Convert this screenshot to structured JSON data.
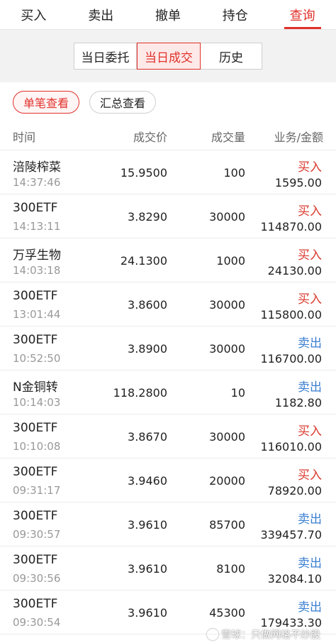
{
  "nav": {
    "tabs": [
      {
        "label": "买入",
        "active": false
      },
      {
        "label": "卖出",
        "active": false
      },
      {
        "label": "撤单",
        "active": false
      },
      {
        "label": "持仓",
        "active": false
      },
      {
        "label": "查询",
        "active": true
      }
    ]
  },
  "segments": [
    {
      "label": "当日委托",
      "active": false
    },
    {
      "label": "当日成交",
      "active": true
    },
    {
      "label": "历史",
      "active": false
    }
  ],
  "chips": [
    {
      "label": "单笔查看",
      "active": true
    },
    {
      "label": "汇总查看",
      "active": false
    }
  ],
  "table": {
    "headers": {
      "time": "时间",
      "price": "成交价",
      "qty": "成交量",
      "amount": "业务/金额"
    },
    "rows": [
      {
        "name": "涪陵榨菜",
        "time": "14:37:46",
        "price": "15.9500",
        "qty": "100",
        "side": "买入",
        "side_type": "buy",
        "amount": "1595.00"
      },
      {
        "name": "300ETF",
        "time": "14:13:11",
        "price": "3.8290",
        "qty": "30000",
        "side": "买入",
        "side_type": "buy",
        "amount": "114870.00"
      },
      {
        "name": "万孚生物",
        "time": "14:03:18",
        "price": "24.1300",
        "qty": "1000",
        "side": "买入",
        "side_type": "buy",
        "amount": "24130.00"
      },
      {
        "name": "300ETF",
        "time": "13:01:44",
        "price": "3.8600",
        "qty": "30000",
        "side": "买入",
        "side_type": "buy",
        "amount": "115800.00"
      },
      {
        "name": "300ETF",
        "time": "10:52:50",
        "price": "3.8900",
        "qty": "30000",
        "side": "卖出",
        "side_type": "sell",
        "amount": "116700.00"
      },
      {
        "name": "N金铜转",
        "time": "10:14:03",
        "price": "118.2800",
        "qty": "10",
        "side": "卖出",
        "side_type": "sell",
        "amount": "1182.80"
      },
      {
        "name": "300ETF",
        "time": "10:10:08",
        "price": "3.8670",
        "qty": "30000",
        "side": "买入",
        "side_type": "buy",
        "amount": "116010.00"
      },
      {
        "name": "300ETF",
        "time": "09:31:17",
        "price": "3.9460",
        "qty": "20000",
        "side": "买入",
        "side_type": "buy",
        "amount": "78920.00"
      },
      {
        "name": "300ETF",
        "time": "09:30:57",
        "price": "3.9610",
        "qty": "85700",
        "side": "卖出",
        "side_type": "sell",
        "amount": "339457.70"
      },
      {
        "name": "300ETF",
        "time": "09:30:56",
        "price": "3.9610",
        "qty": "8100",
        "side": "卖出",
        "side_type": "sell",
        "amount": "32084.10"
      },
      {
        "name": "300ETF",
        "time": "09:30:54",
        "price": "3.9610",
        "qty": "45300",
        "side": "卖出",
        "side_type": "sell",
        "amount": "179433.30"
      }
    ]
  },
  "watermark": {
    "text": "雪球：只做网格不炒股",
    "icon": "snowball-logo-icon"
  },
  "colors": {
    "accent": "#e0312b",
    "buy": "#d93a2f",
    "sell": "#3a7fd0"
  }
}
